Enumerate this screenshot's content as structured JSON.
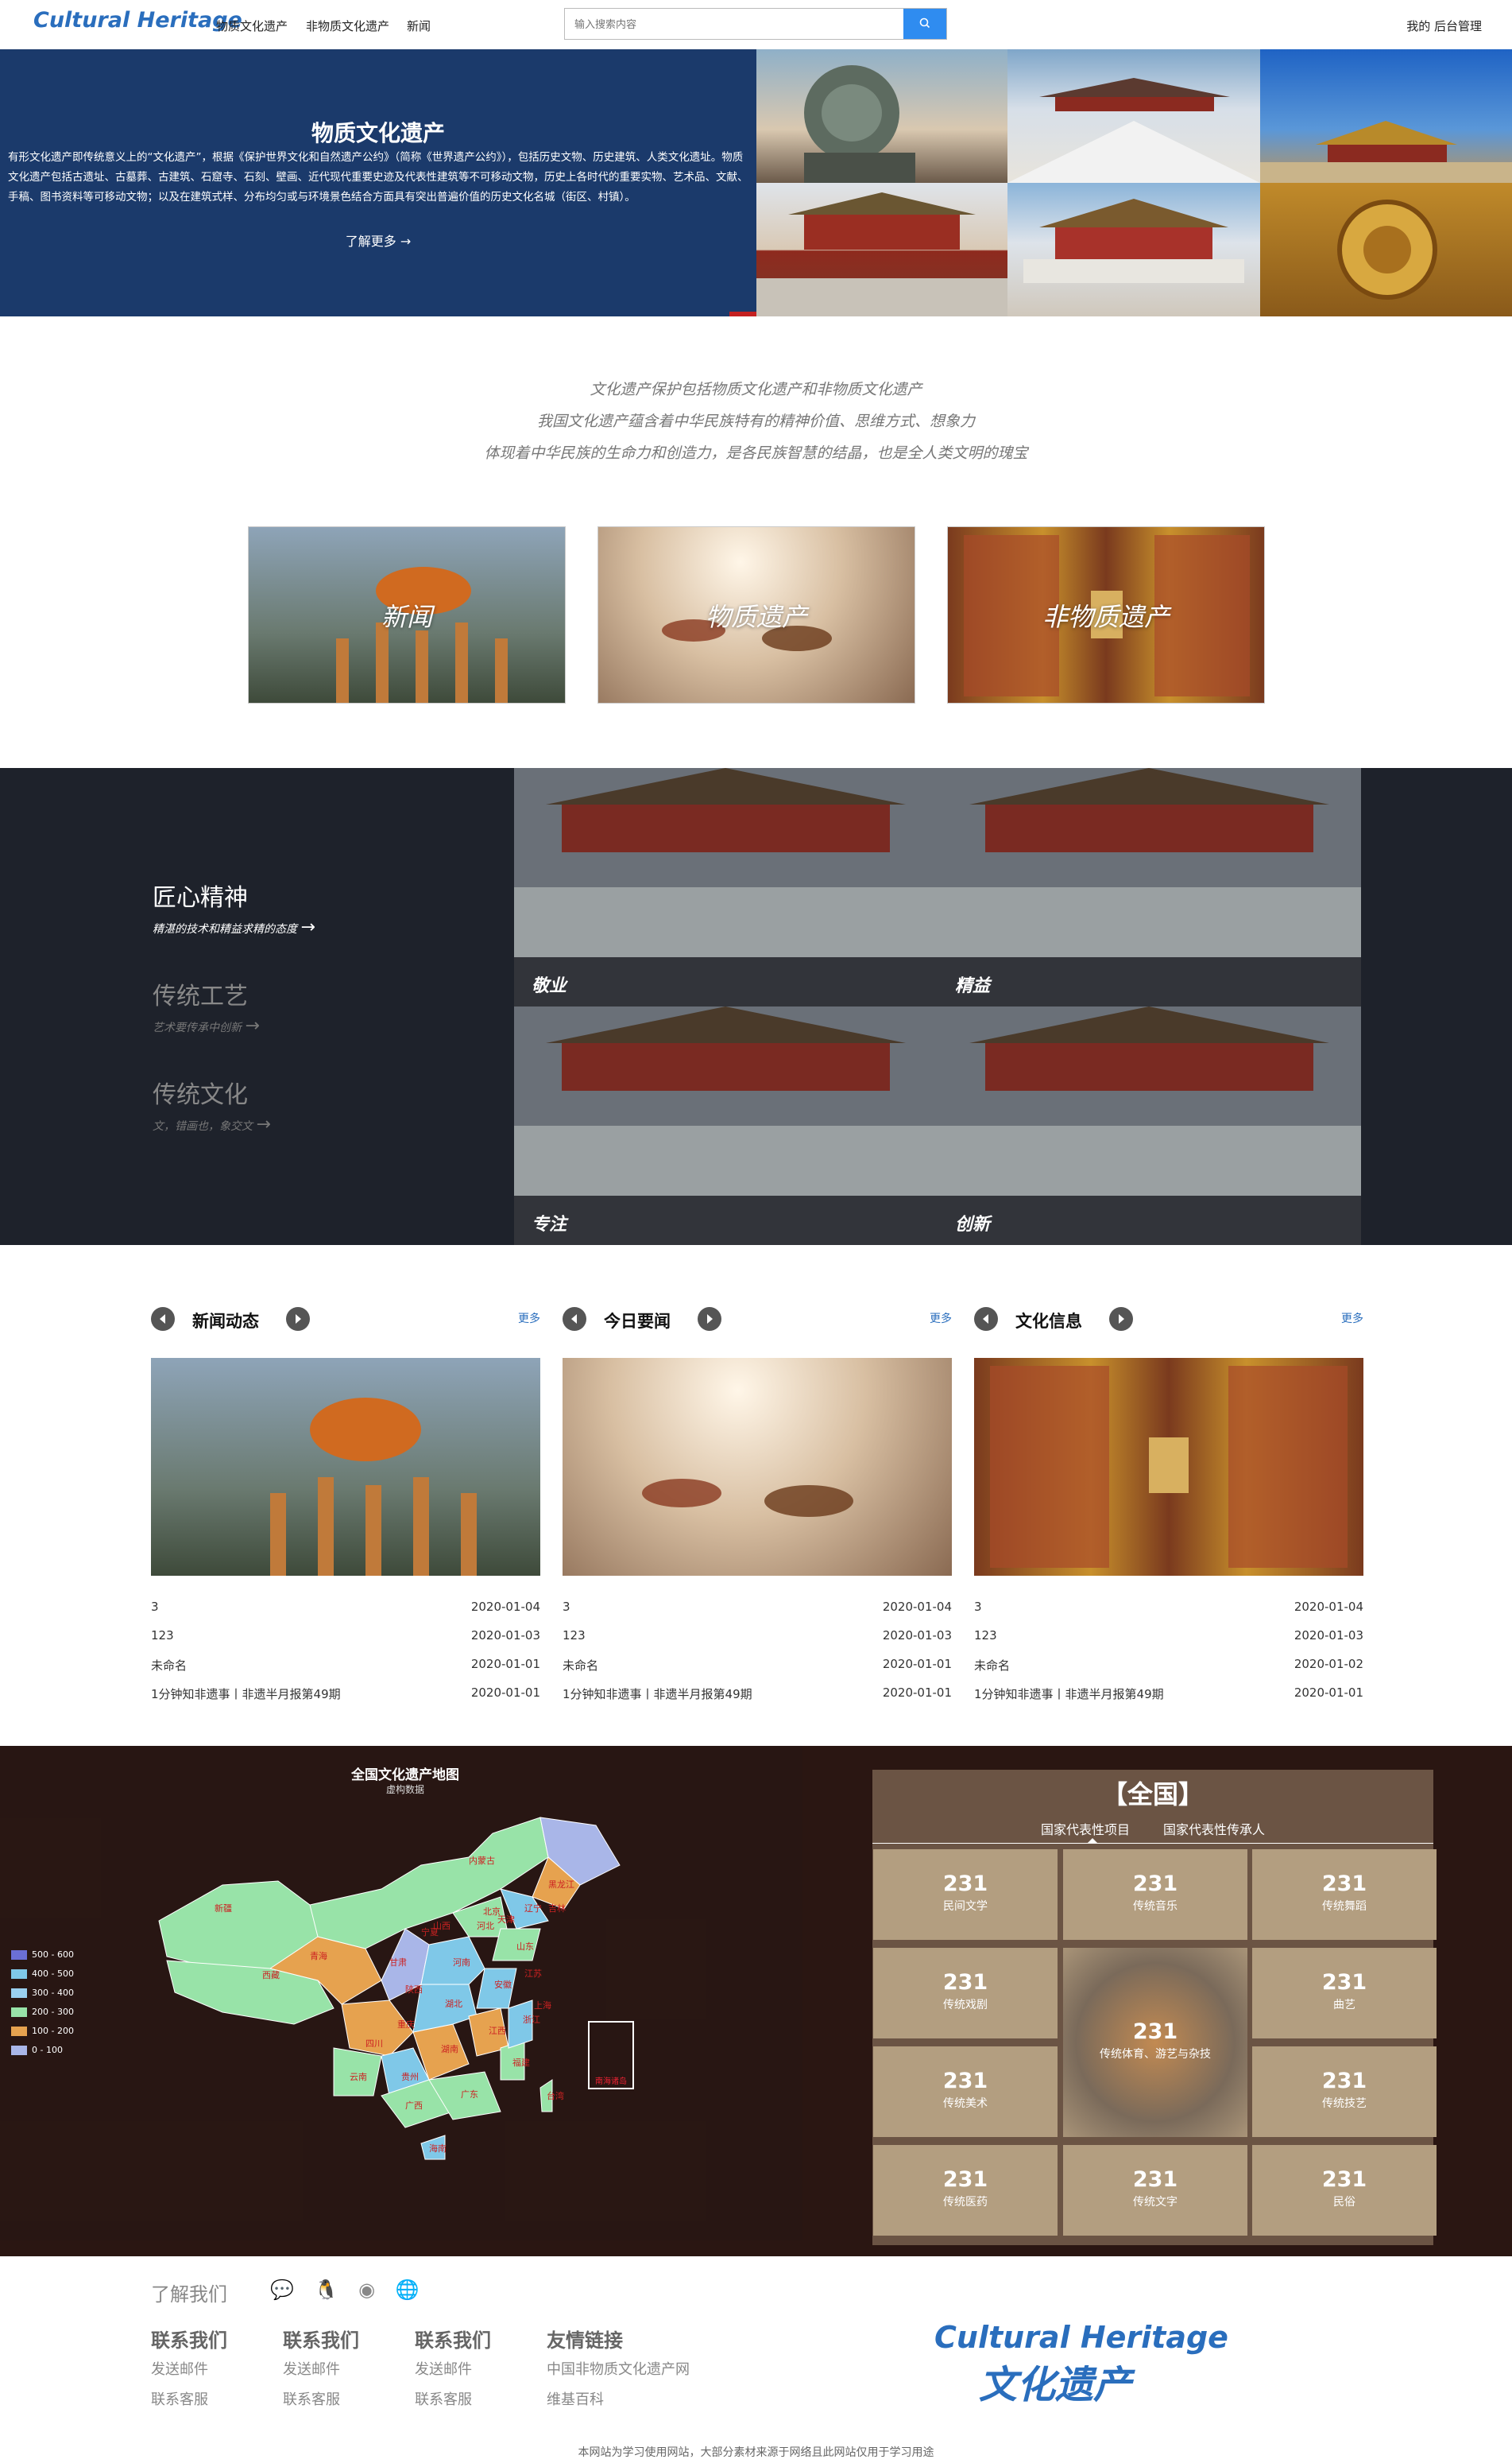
{
  "header": {
    "logo": "Cultural Heritage",
    "nav": [
      "物质文化遗产",
      "非物质文化遗产",
      "新闻"
    ],
    "search_placeholder": "输入搜索内容",
    "right": "我的  后台管理"
  },
  "hero": {
    "title": "物质文化遗产",
    "text": "有形文化遗产即传统意义上的“文化遗产”，根据《保护世界文化和自然遗产公约》（简称《世界遗产公约》），包括历史文物、历史建筑、人类文化遗址。物质文化遗产包括古遗址、古墓葬、古建筑、石窟寺、石刻、壁画、近代现代重要史迹及代表性建筑等不可移动文物，历史上各时代的重要实物、艺术品、文献、手稿、图书资料等可移动文物；以及在建筑式样、分布均匀或与环境景色结合方面具有突出普遍价值的历史文化名城（街区、村镇）。",
    "more": "了解更多 →"
  },
  "intro": [
    "文化遗产保护包括物质文化遗产和非物质文化遗产",
    "我国文化遗产蕴含着中华民族特有的精神价值、思维方式、想象力",
    "体现着中华民族的生命力和创造力，是各民族智慧的结晶，也是全人类文明的瑰宝"
  ],
  "categories": [
    "新闻",
    "物质遗产",
    "非物质遗产"
  ],
  "craft": {
    "items": [
      {
        "title": "匠心精神",
        "sub": "精湛的技术和精益求精的态度"
      },
      {
        "title": "传统工艺",
        "sub": "艺术要传承中创新"
      },
      {
        "title": "传统文化",
        "sub": "文，错画也，象交文"
      }
    ],
    "captions": [
      "敬业",
      "精益",
      "专注",
      "创新"
    ]
  },
  "news": [
    {
      "title": "新闻动态",
      "more": "更多",
      "rows": [
        {
          "t": "3",
          "d": "2020-01-04"
        },
        {
          "t": "123",
          "d": "2020-01-03"
        },
        {
          "t": "未命名",
          "d": "2020-01-01"
        },
        {
          "t": "1分钟知非遗事丨非遗半月报第49期",
          "d": "2020-01-01"
        }
      ]
    },
    {
      "title": "今日要闻",
      "more": "更多",
      "rows": [
        {
          "t": "3",
          "d": "2020-01-04"
        },
        {
          "t": "123",
          "d": "2020-01-03"
        },
        {
          "t": "未命名",
          "d": "2020-01-01"
        },
        {
          "t": "1分钟知非遗事丨非遗半月报第49期",
          "d": "2020-01-01"
        }
      ]
    },
    {
      "title": "文化信息",
      "more": "更多",
      "rows": [
        {
          "t": "3",
          "d": "2020-01-04"
        },
        {
          "t": "123",
          "d": "2020-01-03"
        },
        {
          "t": "未命名",
          "d": "2020-01-02"
        },
        {
          "t": "1分钟知非遗事丨非遗半月报第49期",
          "d": "2020-01-01"
        }
      ]
    }
  ],
  "map": {
    "title": "全国文化遗产地图",
    "subtitle": "虚构数据",
    "legend": [
      {
        "label": "500 - 600",
        "color": "#6b6fd6"
      },
      {
        "label": "400 - 500",
        "color": "#7fc8e8"
      },
      {
        "label": "300 - 400",
        "color": "#9ad0f0"
      },
      {
        "label": "200 - 300",
        "color": "#98e3a8"
      },
      {
        "label": "100 - 200",
        "color": "#e6a24f"
      },
      {
        "label": "0 - 100",
        "color": "#a9b6e8"
      }
    ],
    "provinces": [
      "黑龙江",
      "吉林",
      "辽宁",
      "内蒙古",
      "新疆",
      "西藏",
      "青海",
      "甘肃",
      "四川",
      "云南",
      "贵州",
      "广西",
      "广东",
      "湖南",
      "湖北",
      "河南",
      "河北",
      "山东",
      "山西",
      "陕西",
      "江西",
      "福建",
      "浙江",
      "安徽",
      "江苏",
      "重庆",
      "宁夏",
      "海南",
      "台湾",
      "北京",
      "天津",
      "上海"
    ],
    "inset": "南海诸岛"
  },
  "nation": {
    "title": "【全国】",
    "tabs": [
      "国家代表性项目",
      "国家代表性传承人"
    ],
    "stats": [
      {
        "n": "231",
        "l": "民间文学"
      },
      {
        "n": "231",
        "l": "传统音乐"
      },
      {
        "n": "231",
        "l": "传统舞蹈"
      },
      {
        "n": "231",
        "l": "传统戏剧"
      },
      {
        "n": "231",
        "l": "传统体育、游艺与杂技"
      },
      {
        "n": "231",
        "l": "曲艺"
      },
      {
        "n": "231",
        "l": "传统美术"
      },
      {
        "n": "231",
        "l": "传统技艺"
      },
      {
        "n": "231",
        "l": "传统医药"
      },
      {
        "n": "231",
        "l": "传统文字"
      },
      {
        "n": "231",
        "l": "民俗"
      }
    ]
  },
  "footer": {
    "about": "了解我们",
    "cols": [
      {
        "h": "联系我们",
        "a": "发送邮件",
        "b": "联系客服"
      },
      {
        "h": "联系我们",
        "a": "发送邮件",
        "b": "联系客服"
      },
      {
        "h": "联系我们",
        "a": "发送邮件",
        "b": "联系客服"
      },
      {
        "h": "友情链接",
        "a": "中国非物质文化遗产网",
        "b": "维基百科"
      }
    ],
    "logo_en": "Cultural Heritage",
    "logo_cn": "文化遗产",
    "note": "本网站为学习使用网站，大部分素材来源于网络且此网站仅用于学习用途"
  }
}
